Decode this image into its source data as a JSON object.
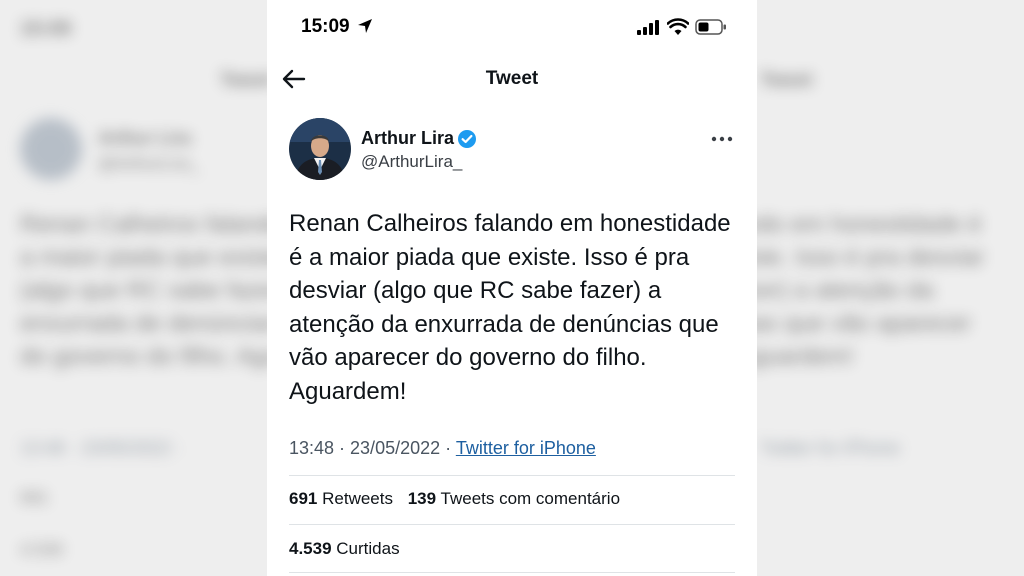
{
  "status_bar": {
    "time": "15:09"
  },
  "nav": {
    "title": "Tweet"
  },
  "author": {
    "name": "Arthur Lira",
    "handle": "@ArthurLira_"
  },
  "tweet": {
    "text": "Renan Calheiros falando em honestidade é a maior piada que existe. Isso é pra desviar (algo que RC sabe fazer) a atenção da enxurrada de denúncias que vão aparecer do governo do filho. Aguardem!",
    "timestamp": "13:48 · 23/05/2022 · ",
    "source": "Twitter for iPhone"
  },
  "stats": {
    "retweets_count": "691",
    "retweets_label": "Retweets",
    "quotes_count": "139",
    "quotes_label": "Tweets com comentário",
    "likes_count": "4.539",
    "likes_label": "Curtidas"
  },
  "icons": {
    "verified": "verified-badge-icon",
    "back": "arrow-left-icon",
    "more": "more-horizontal-icon",
    "location": "location-arrow-icon",
    "signal": "cellular-signal-icon",
    "wifi": "wifi-icon",
    "battery": "battery-icon"
  },
  "colors": {
    "verified_blue": "#1d9bf0",
    "link_blue": "#1d5fa0",
    "text_primary": "#0f1419"
  }
}
